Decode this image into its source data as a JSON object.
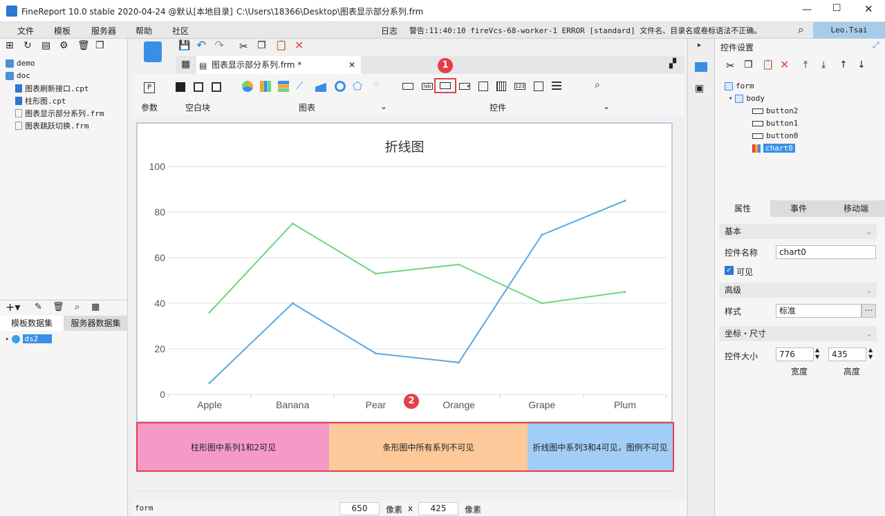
{
  "window": {
    "title": "FineReport 10.0 stable 2020-04-24 @默认[本地目录]",
    "path": "C:\\Users\\18366\\Desktop\\图表显示部分系列.frm"
  },
  "menu": [
    "文件",
    "模板",
    "服务器",
    "帮助",
    "社区"
  ],
  "log": {
    "label": "日志",
    "warning": "警告:11:40:10 fireVcs-68-worker-1 ERROR [standard] 文件名、目录名或卷标语法不正确。"
  },
  "user": "Leo.Tsai",
  "file_tree": [
    {
      "name": "demo",
      "type": "folder"
    },
    {
      "name": "doc",
      "type": "folder"
    },
    {
      "name": "图表刷新接口.cpt",
      "type": "cpt"
    },
    {
      "name": "柱形图.cpt",
      "type": "cpt"
    },
    {
      "name": "图表显示部分系列.frm",
      "type": "frm"
    },
    {
      "name": "图表跳跃切换.frm",
      "type": "frm"
    }
  ],
  "dataset_tabs": [
    "模板数据集",
    "服务器数据集"
  ],
  "datasets": [
    "ds2"
  ],
  "editor_tab": "图表显示部分系列.frm *",
  "toolbar_groups": {
    "param": "参数",
    "blank": "空白块",
    "chart": "图表",
    "widget": "控件"
  },
  "badges": {
    "one": "1",
    "two": "2"
  },
  "chart_data": {
    "type": "line",
    "title": "折线图",
    "categories": [
      "Apple",
      "Banana",
      "Pear",
      "Orange",
      "Grape",
      "Plum"
    ],
    "ylim": [
      0,
      100
    ],
    "yticks": [
      0,
      20,
      40,
      60,
      80,
      100
    ],
    "series": [
      {
        "color": "#5aa8e0",
        "values": [
          5,
          40,
          18,
          14,
          70,
          85
        ]
      },
      {
        "color": "#6dd47e",
        "values": [
          36,
          75,
          53,
          57,
          40,
          45
        ]
      }
    ],
    "grid": true
  },
  "buttons": [
    {
      "label": "柱形图中系列1和2可见",
      "color": "#f59ac8"
    },
    {
      "label": "条形图中所有系列不可见",
      "color": "#fdc99a"
    },
    {
      "label": "折线图中系列3和4可见，图例不可见",
      "color": "#a2cdf7"
    }
  ],
  "status": {
    "left": "form",
    "width": "650",
    "unit1": "像素",
    "x": "x",
    "height": "425",
    "unit2": "像素"
  },
  "right": {
    "title": "控件设置",
    "tree": [
      "form",
      "body",
      "button2",
      "button1",
      "button0",
      "chart0"
    ],
    "tabs": [
      "属性",
      "事件",
      "移动端"
    ],
    "basic": "基本",
    "name_label": "控件名称",
    "name_value": "chart0",
    "visible": "可见",
    "advanced": "高级",
    "style_label": "样式",
    "style_value": "标准",
    "coord": "坐标・尺寸",
    "size_label": "控件大小",
    "width_value": "776",
    "height_value": "435",
    "width_label": "宽度",
    "height_label": "高度"
  }
}
